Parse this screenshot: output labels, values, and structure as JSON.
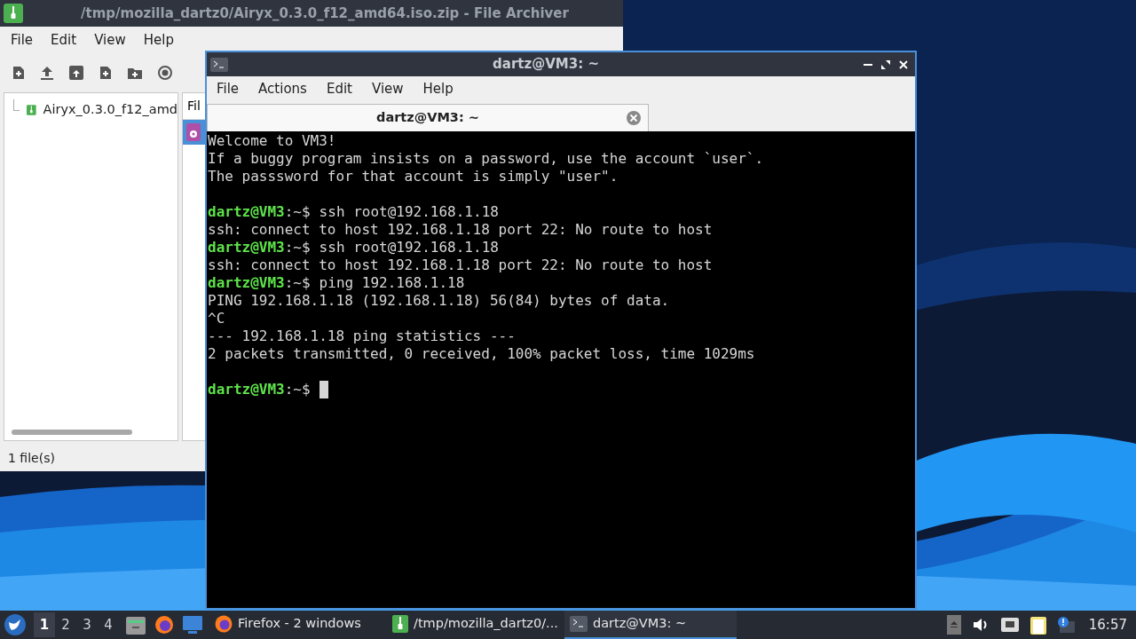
{
  "archiver": {
    "title": "/tmp/mozilla_dartz0/Airyx_0.3.0_f12_amd64.iso.zip - File Archiver",
    "menu": [
      "File",
      "Edit",
      "View",
      "Help"
    ],
    "tree": [
      {
        "label": "Airyx_0.3.0_f12_amd",
        "selected": false
      }
    ],
    "list_header": "Fil",
    "list_rows": [
      {
        "selected": true
      }
    ],
    "status": "1 file(s)"
  },
  "terminal": {
    "title": "dartz@VM3: ~",
    "menu": [
      "File",
      "Actions",
      "Edit",
      "View",
      "Help"
    ],
    "tabs": [
      {
        "label": "dartz@VM3: ~",
        "selected": true
      }
    ],
    "lines": [
      {
        "kind": "output",
        "text": "Welcome to VM3!"
      },
      {
        "kind": "output",
        "text": "If a buggy program insists on a password, use the account `user`."
      },
      {
        "kind": "output",
        "text": "The passsword for that account is simply \"user\"."
      },
      {
        "kind": "blank"
      },
      {
        "kind": "prompt",
        "user": "dartz@VM3",
        "path": ":~$",
        "command": "ssh root@192.168.1.18"
      },
      {
        "kind": "output",
        "text": "ssh: connect to host 192.168.1.18 port 22: No route to host"
      },
      {
        "kind": "prompt",
        "user": "dartz@VM3",
        "path": ":~$",
        "command": "ssh root@192.168.1.18"
      },
      {
        "kind": "output",
        "text": "ssh: connect to host 192.168.1.18 port 22: No route to host"
      },
      {
        "kind": "prompt",
        "user": "dartz@VM3",
        "path": ":~$",
        "command": "ping 192.168.1.18"
      },
      {
        "kind": "output",
        "text": "PING 192.168.1.18 (192.168.1.18) 56(84) bytes of data."
      },
      {
        "kind": "output",
        "text": "^C"
      },
      {
        "kind": "output",
        "text": "--- 192.168.1.18 ping statistics ---"
      },
      {
        "kind": "output",
        "text": "2 packets transmitted, 0 received, 100% packet loss, time 1029ms"
      },
      {
        "kind": "blank"
      },
      {
        "kind": "prompt",
        "user": "dartz@VM3",
        "path": ":~$",
        "cursor": true
      }
    ]
  },
  "taskbar": {
    "workspaces": [
      {
        "label": "1",
        "selected": true
      },
      {
        "label": "2",
        "selected": false
      },
      {
        "label": "3",
        "selected": false
      },
      {
        "label": "4",
        "selected": false
      }
    ],
    "tasks": [
      {
        "kind": "firefox",
        "label": "Firefox - 2 windows",
        "selected": false
      },
      {
        "kind": "archive",
        "label": "/tmp/mozilla_dartz0/...",
        "selected": false
      },
      {
        "kind": "terminal",
        "label": "dartz@VM3: ~",
        "selected": true
      }
    ],
    "clock": "16:57"
  }
}
